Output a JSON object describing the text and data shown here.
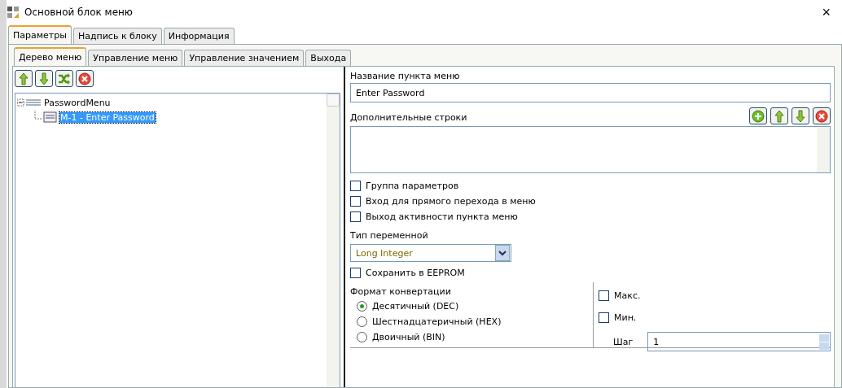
{
  "window": {
    "title": "Основной блок меню",
    "close": "×"
  },
  "tabs": [
    {
      "label": "Параметры",
      "selected": true
    },
    {
      "label": "Надпись к блоку",
      "selected": false
    },
    {
      "label": "Информация",
      "selected": false
    }
  ],
  "subtabs": [
    {
      "label": "Дерево меню",
      "selected": true
    },
    {
      "label": "Управление меню",
      "selected": false
    },
    {
      "label": "Управление значением",
      "selected": false
    },
    {
      "label": "Выхода",
      "selected": false
    }
  ],
  "tree": [
    {
      "label": "PasswordMenu",
      "selected": false,
      "expanded": true,
      "children": [
        {
          "label": "M-1 - Enter Password",
          "selected": true
        }
      ]
    }
  ],
  "name_field": {
    "label": "Название пункта меню",
    "value": "Enter Password"
  },
  "extra_lines": {
    "label": "Дополнительные строки"
  },
  "options": [
    {
      "label": "Группа параметров",
      "checked": false
    },
    {
      "label": "Вход для прямого перехода в меню",
      "checked": false
    },
    {
      "label": "Выход активности пункта меню",
      "checked": false
    }
  ],
  "variable_type": {
    "label": "Тип переменной",
    "value": "Long Integer"
  },
  "eeprom": {
    "label": "Сохранить в EEPROM",
    "checked": false
  },
  "conversion": {
    "label": "Формат конвертации",
    "options": [
      {
        "label": "Десятичный (DEC)",
        "selected": true
      },
      {
        "label": "Шестнадцатеричный (HEX)",
        "selected": false
      },
      {
        "label": "Двоичный (BIN)",
        "selected": false
      }
    ]
  },
  "limits": [
    {
      "label": "Макс.",
      "checked": false
    },
    {
      "label": "Мин.",
      "checked": false
    }
  ],
  "step": {
    "label": "Шаг",
    "value": "1"
  }
}
